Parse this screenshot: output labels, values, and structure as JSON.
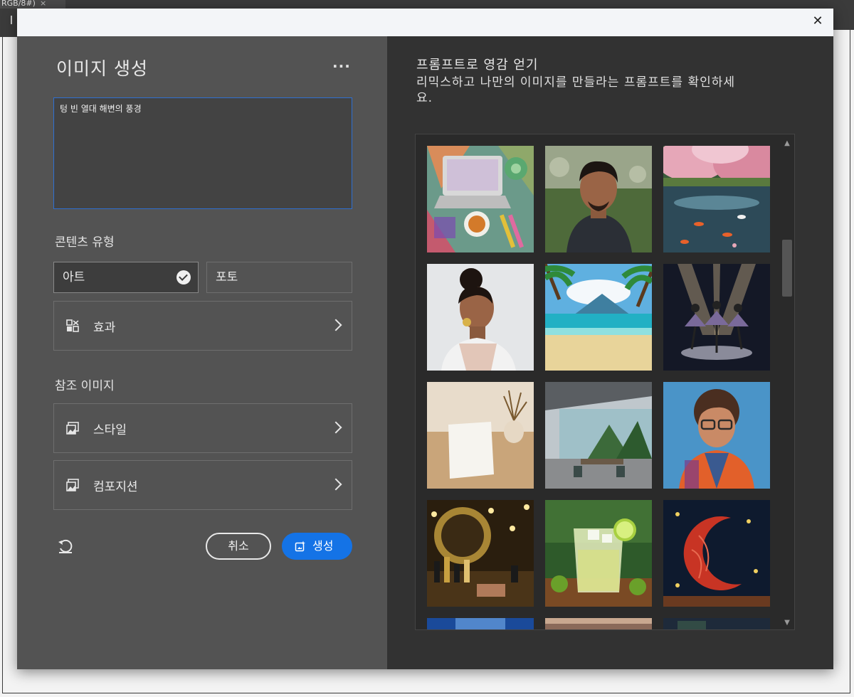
{
  "background_tab": {
    "label": "RGB/8#)",
    "close_glyph": "×"
  },
  "dialog": {
    "close_label": "✕",
    "left": {
      "title": "이미지 생성",
      "more_label": "···",
      "prompt_value": "텅 빈 열대 해변의 풍경",
      "content_type_label": "콘텐츠 유형",
      "content_types": [
        {
          "label": "아트",
          "selected": true
        },
        {
          "label": "포토",
          "selected": false
        }
      ],
      "effects_label": "효과",
      "reference_label": "참조 이미지",
      "style_label": "스타일",
      "composition_label": "컴포지션",
      "cancel_label": "취소",
      "generate_label": "생성"
    },
    "right": {
      "title": "프롬프트로 영감 얻기",
      "description": "리믹스하고 나만의 이미지를 만들라는 프롬프트를 확인하세요.",
      "scroll_position": 0.22
    }
  },
  "colors": {
    "accent": "#1473e6",
    "panel": "#535353",
    "gallery": "#323232"
  },
  "icons": [
    "close-icon",
    "more-icon",
    "check-icon",
    "effects-icon",
    "image-reference-icon",
    "chevron-right-icon",
    "reset-icon",
    "generate-icon"
  ],
  "gallery_items": [
    "desk-with-laptop-and-tea",
    "portrait-of-man-outdoors",
    "cherry-blossom-pond-with-koi",
    "woman-with-earrings-profile",
    "tropical-beach-illustration",
    "ballet-dancers-on-stage",
    "open-book-and-vase",
    "modern-glass-office",
    "3d-woman-with-glasses",
    "makeup-vanity-with-lights",
    "lime-cocktail-drink",
    "red-yarn-crescent-moon",
    "starry-sky-partial",
    "sunset-sky-partial",
    "night-forest-partial"
  ]
}
